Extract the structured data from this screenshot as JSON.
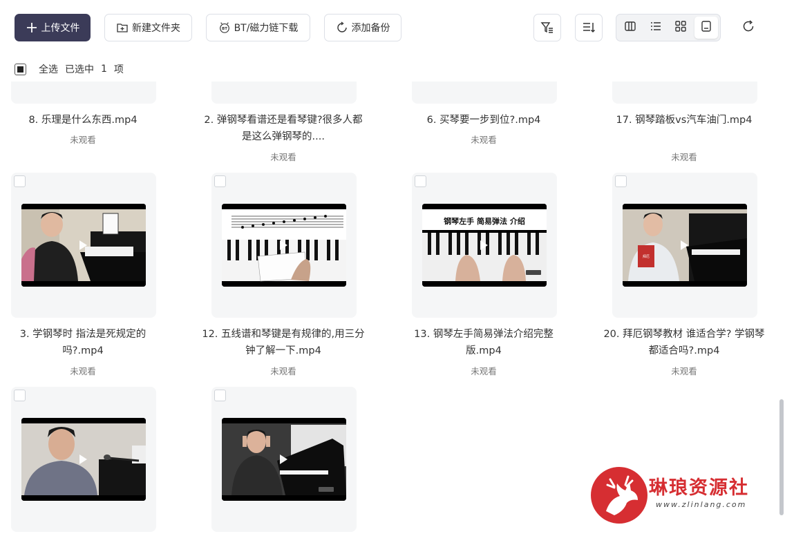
{
  "toolbar": {
    "upload_label": "上传文件",
    "newfolder_label": "新建文件夹",
    "bt_label": "BT/磁力链下载",
    "backup_label": "添加备份"
  },
  "selection": {
    "select_all": "全选",
    "selected_prefix": "已选中",
    "count": "1",
    "unit": "项"
  },
  "files": [
    {
      "name": "8. 乐理是什么东西.mp4",
      "status": "未观看"
    },
    {
      "name": "2. 弹钢琴看谱还是看琴键?很多人都是这么弹钢琴的....",
      "status": "未观看"
    },
    {
      "name": "6. 买琴要一步到位?.mp4",
      "status": "未观看"
    },
    {
      "name": "17. 钢琴踏板vs汽车油门.mp4",
      "status": "未观看"
    },
    {
      "name": "3. 学钢琴时 指法是死规定的吗?.mp4",
      "status": "未观看"
    },
    {
      "name": "12. 五线谱和琴键是有规律的,用三分钟了解一下.mp4",
      "status": "未观看"
    },
    {
      "name": "13. 钢琴左手简易弹法介绍完整版.mp4",
      "status": "未观看"
    },
    {
      "name": "20. 拜厄钢琴教材 谁适合学? 学钢琴都适合吗?.mp4",
      "status": "未观看"
    },
    {
      "name": "",
      "status": ""
    },
    {
      "name": "",
      "status": ""
    }
  ],
  "thumb_captions": {
    "left_hand_title": "钢琴左手 简易弹法 介绍",
    "bayer_book": "拜厄"
  },
  "watermark": {
    "name": "琳琅资源社",
    "url": "www.zlinlang.com"
  },
  "colors": {
    "accent": "#3b3b58",
    "card_bg": "#f5f6f7",
    "watermark_red": "#d62e32"
  }
}
